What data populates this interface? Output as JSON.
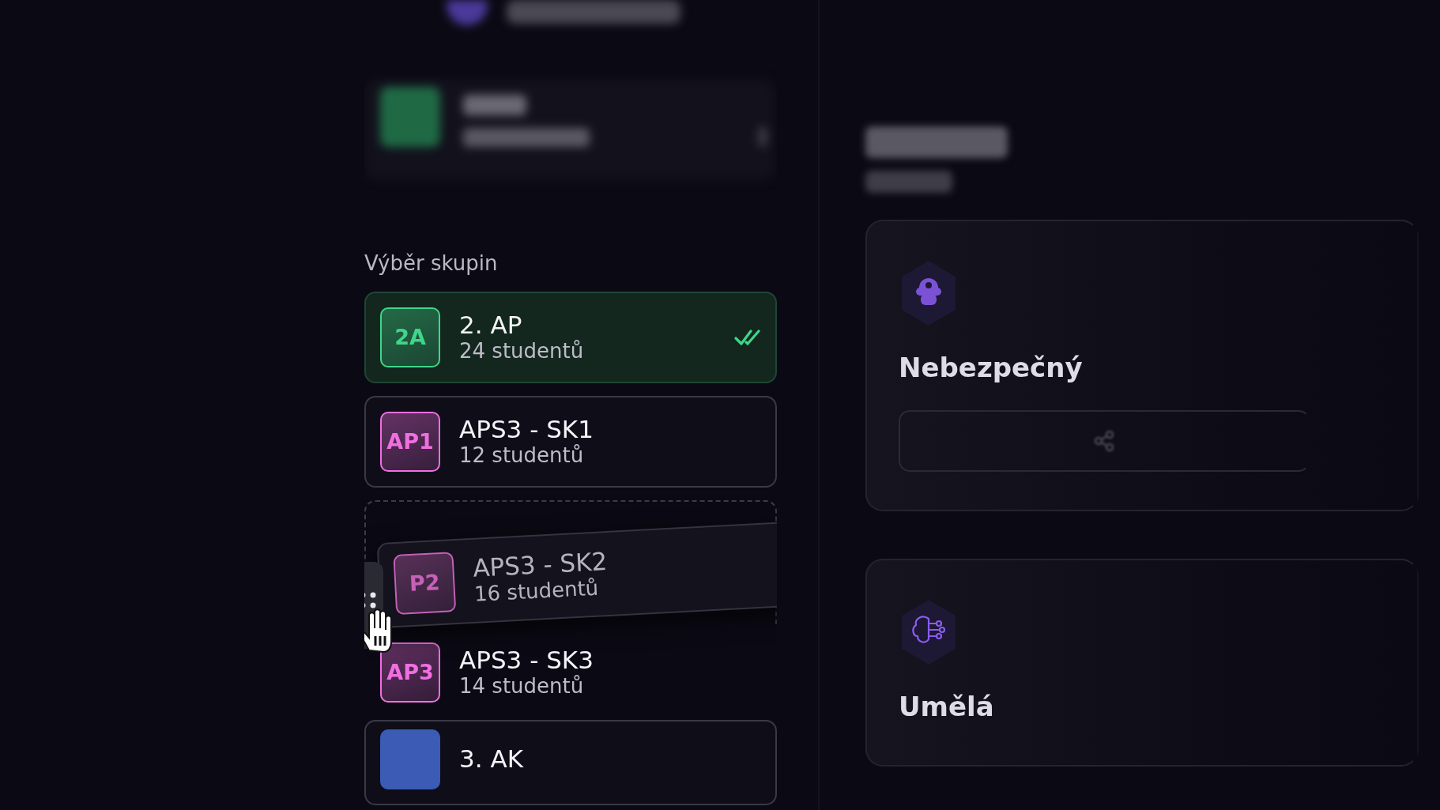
{
  "heading": "Výběr skupin",
  "groups": [
    {
      "kind": "item",
      "code": "2A",
      "name": "2. AP",
      "count": "24 studentů",
      "color": "#3fd68a",
      "selected": true
    },
    {
      "kind": "item",
      "code": "AP1",
      "name": "APS3 - SK1",
      "count": "12 studentů",
      "color": "#f06fe0",
      "selected": false
    },
    {
      "kind": "dragging",
      "code": "P2",
      "name": "APS3 - SK2",
      "count": "16 studentů",
      "color": "#c761b8",
      "selected": false
    },
    {
      "kind": "item",
      "code": "AP3",
      "name": "APS3 - SK3",
      "count": "14 studentů",
      "color": "#f06fe0",
      "selected": false
    },
    {
      "kind": "item",
      "name": "3. AK",
      "color": "#3b5bb5",
      "selected": false
    }
  ],
  "topics": [
    {
      "kind": "shield",
      "title": "Nebezpečný",
      "share_button": true
    },
    {
      "kind": "brain",
      "title": "Umělá",
      "share_button": false
    }
  ]
}
